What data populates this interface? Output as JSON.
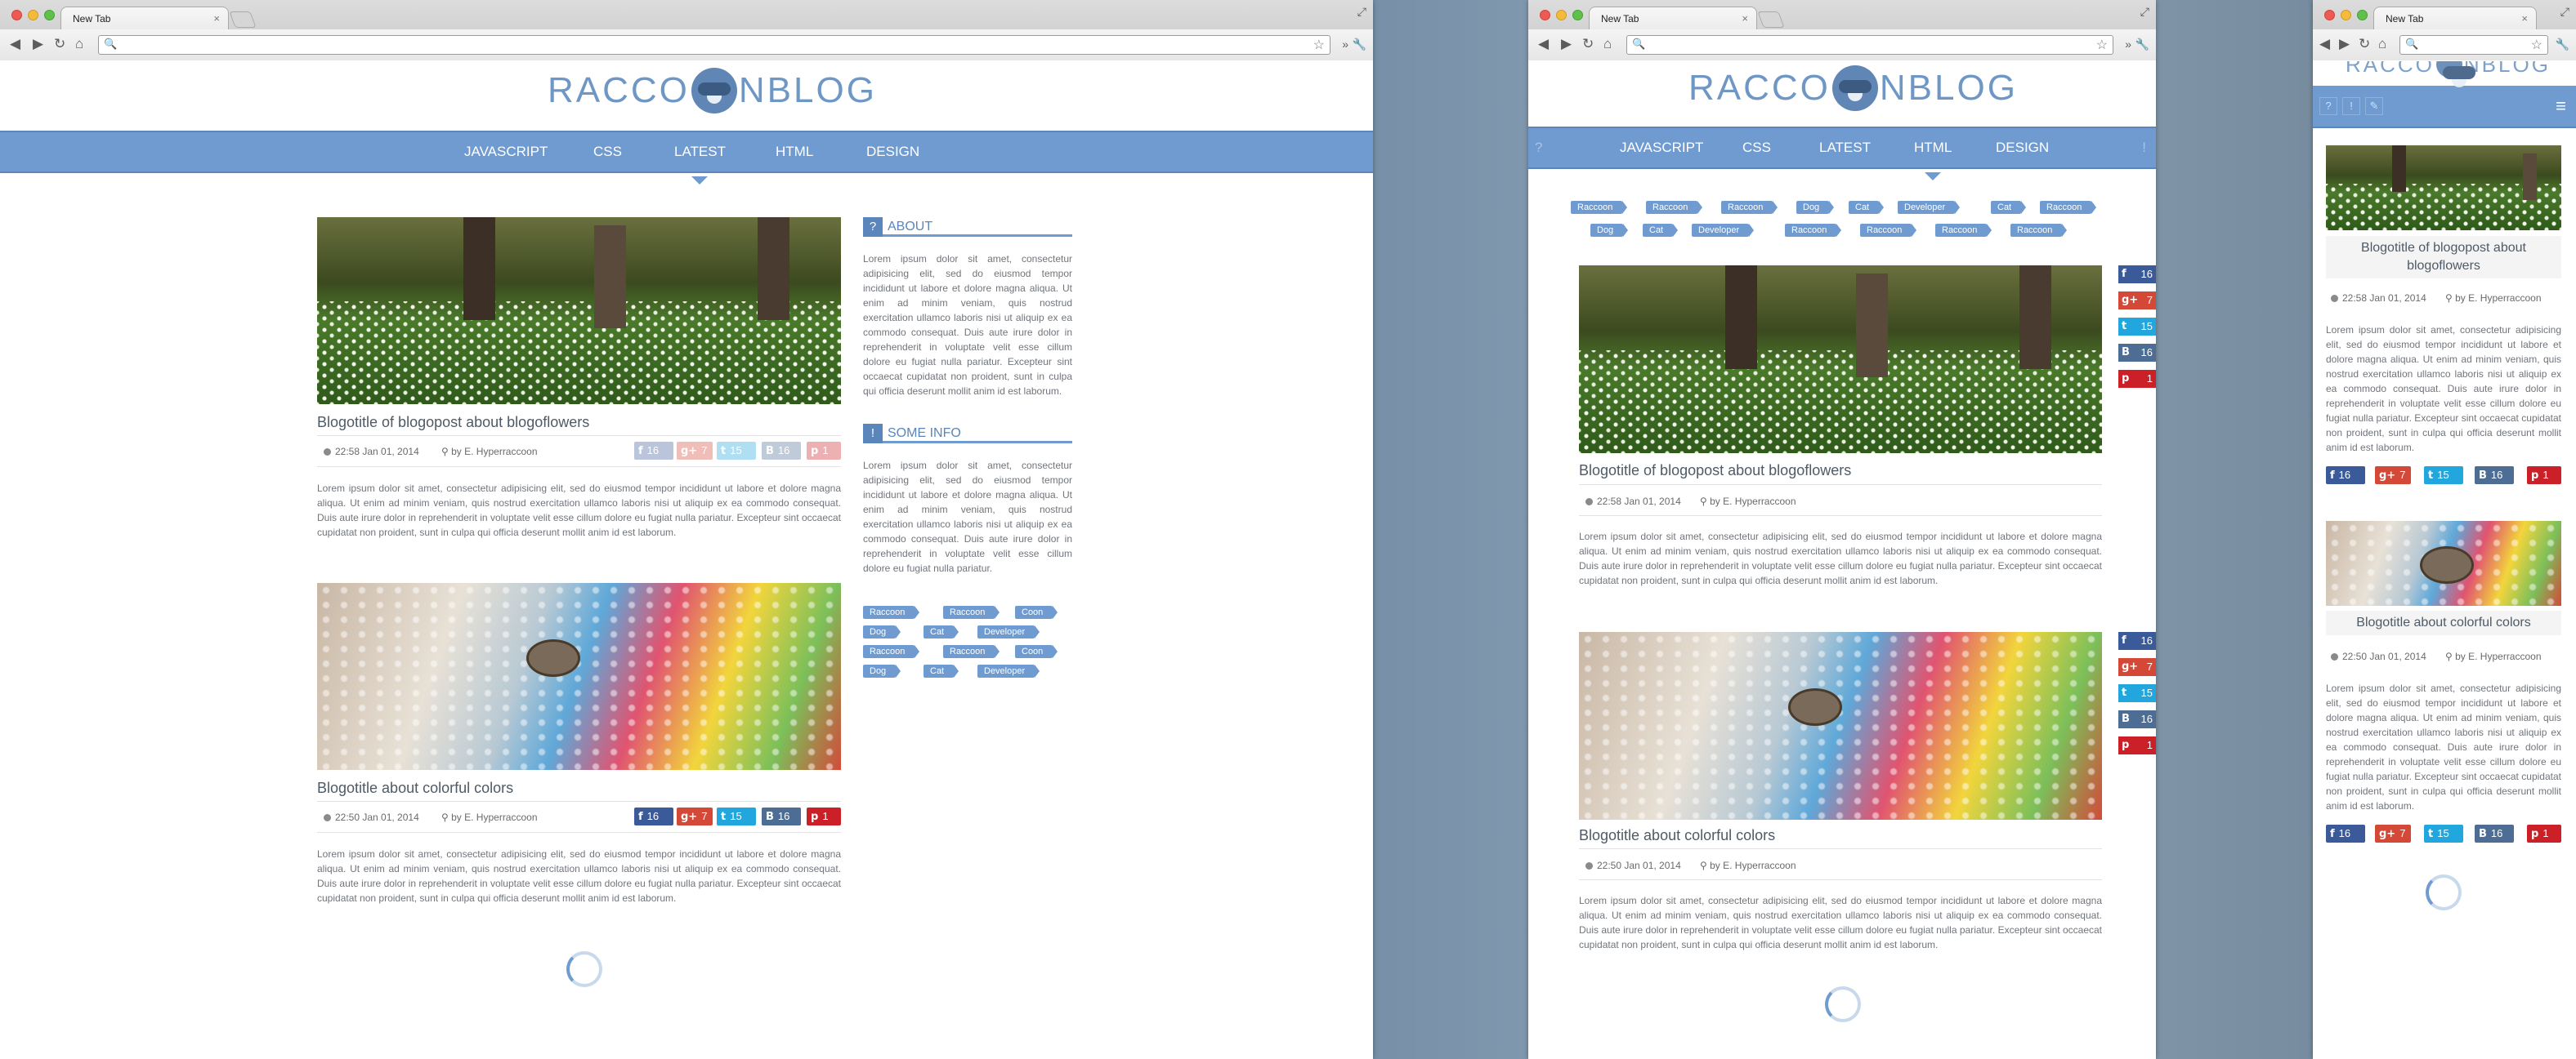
{
  "browser": {
    "tab_title": "New Tab",
    "tab_close": "×",
    "back": "◀",
    "forward": "▶",
    "reload": "↻",
    "home": "⌂",
    "star": "☆",
    "wrench": "🔧",
    "more": "»",
    "search_icon": "🔍"
  },
  "logo": {
    "left": "RACCO",
    "right": "NBLOG"
  },
  "nav": {
    "items": [
      "JAVASCRIPT",
      "CSS",
      "LATEST",
      "HTML",
      "DESIGN"
    ]
  },
  "posts": [
    {
      "title": "Blogotitle of blogopost about blogoflowers",
      "date": "22:58 Jan 01, 2014",
      "author": "by E. Hyperraccoon",
      "body": "Lorem ipsum dolor sit amet, consectetur adipisicing elit, sed do eiusmod tempor incididunt ut labore et dolore magna aliqua. Ut enim ad minim veniam, quis nostrud exercitation ullamco laboris nisi ut aliquip ex ea commodo consequat. Duis aute irure dolor in reprehenderit in voluptate velit esse cillum dolore eu fugiat nulla pariatur. Excepteur sint occaecat cupidatat non proident, sunt in culpa qui officia deserunt mollit anim id est laborum."
    },
    {
      "title": "Blogotitle about colorful colors",
      "date": "22:50 Jan 01, 2014",
      "author": "by E. Hyperraccoon",
      "body": "Lorem ipsum dolor sit amet, consectetur adipisicing elit, sed do eiusmod tempor incididunt ut labore et dolore magna aliqua. Ut enim ad minim veniam, quis nostrud exercitation ullamco laboris nisi ut aliquip ex ea commodo consequat. Duis aute irure dolor in reprehenderit in voluptate velit esse cillum dolore eu fugiat nulla pariatur. Excepteur sint occaecat cupidatat non proident, sunt in culpa qui officia deserunt mollit anim id est laborum."
    }
  ],
  "social": {
    "fb": "16",
    "gp": "7",
    "tw": "15",
    "vk": "16",
    "pin": "1",
    "fb_icon": "f",
    "gp_icon": "g+",
    "tw_icon": "t",
    "vk_icon": "B",
    "pin_icon": "p"
  },
  "sidebar": {
    "about_icon": "?",
    "about_title": "ABOUT",
    "about_text": "Lorem ipsum dolor sit amet, consectetur adipisicing elit, sed do eiusmod tempor incididunt ut labore et dolore magna aliqua. Ut enim ad minim veniam, quis nostrud exercitation ullamco laboris nisi ut aliquip ex ea commodo consequat. Duis aute irure dolor in reprehenderit in voluptate velit esse cillum dolore eu fugiat nulla pariatur. Excepteur sint occaecat cupidatat non proident, sunt in culpa qui officia deserunt mollit anim id est laborum.",
    "info_icon": "!",
    "info_title": "SOME INFO",
    "info_text": "Lorem ipsum dolor sit amet, consectetur adipisicing elit, sed do eiusmod tempor incididunt ut labore et dolore magna aliqua. Ut enim ad minim veniam, quis nostrud exercitation ullamco laboris nisi ut aliquip ex ea commodo consequat. Duis aute irure dolor in reprehenderit in voluptate velit esse cillum dolore eu fugiat nulla pariatur.",
    "tags": [
      "Raccoon",
      "Raccoon",
      "Coon",
      "Dog",
      "Cat",
      "Developer",
      "Raccoon",
      "Raccoon",
      "Coon",
      "Dog",
      "Cat",
      "Developer"
    ]
  },
  "mid_tags": [
    "Raccoon",
    "Raccoon",
    "Raccoon",
    "Dog",
    "Cat",
    "Developer",
    "Cat",
    "Raccoon",
    "Dog",
    "Cat",
    "Developer",
    "Raccoon",
    "Raccoon",
    "Raccoon",
    "Raccoon"
  ],
  "mid_nav_icons": {
    "left": "?",
    "right": "!"
  },
  "mobile": {
    "icons": [
      "?",
      "!",
      "✎"
    ],
    "menu": "≡"
  }
}
